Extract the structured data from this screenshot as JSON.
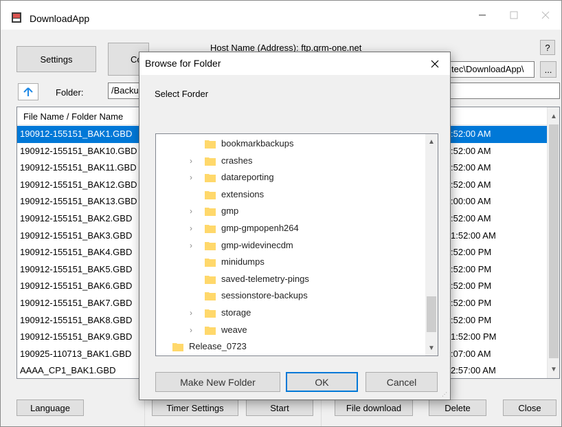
{
  "window": {
    "title": "DownloadApp"
  },
  "colors": {
    "selection": "#0078d7",
    "window_bg": "#f0f0f0"
  },
  "toolbar": {
    "settings_label": "Settings",
    "connect_label_partial": "Co",
    "host_label": "Host Name (Address): ftp.grm-one.net",
    "help_label": "?",
    "local_path": "tec\\DownloadApp\\",
    "browse_label": "...",
    "up_icon": "up-arrow-icon",
    "folder_label": "Folder:",
    "folder_value": "/Backu"
  },
  "file_list": {
    "header_name": "File Name / Folder Name",
    "rows": [
      {
        "name": "190912-155151_BAK1.GBD",
        "time": ":52:00 AM"
      },
      {
        "name": "190912-155151_BAK10.GBD",
        "time": ":52:00 AM"
      },
      {
        "name": "190912-155151_BAK11.GBD",
        "time": ":52:00 AM"
      },
      {
        "name": "190912-155151_BAK12.GBD",
        "time": ":52:00 AM"
      },
      {
        "name": "190912-155151_BAK13.GBD",
        "time": ":00:00 AM"
      },
      {
        "name": "190912-155151_BAK2.GBD",
        "time": ":52:00 AM"
      },
      {
        "name": "190912-155151_BAK3.GBD",
        "time": "1:52:00 AM"
      },
      {
        "name": "190912-155151_BAK4.GBD",
        "time": ":52:00 PM"
      },
      {
        "name": "190912-155151_BAK5.GBD",
        "time": ":52:00 PM"
      },
      {
        "name": "190912-155151_BAK6.GBD",
        "time": ":52:00 PM"
      },
      {
        "name": "190912-155151_BAK7.GBD",
        "time": ":52:00 PM"
      },
      {
        "name": "190912-155151_BAK8.GBD",
        "time": ":52:00 PM"
      },
      {
        "name": "190912-155151_BAK9.GBD",
        "time": "1:52:00 PM"
      },
      {
        "name": "190925-110713_BAK1.GBD",
        "time": ":07:00 AM"
      },
      {
        "name": "AAAA_CP1_BAK1.GBD",
        "time": "2:57:00 AM"
      }
    ]
  },
  "bottom_bar": {
    "language_label": "Language",
    "timer_settings_label": "Timer Settings",
    "start_label": "Start",
    "file_download_label": "File download",
    "delete_label": "Delete",
    "close_label": "Close"
  },
  "dialog": {
    "title": "Browse for Folder",
    "subtitle": "Select Forder",
    "folder_color": "#ffd86b",
    "tree": [
      {
        "label": "bookmarkbackups",
        "expandable": false
      },
      {
        "label": "crashes",
        "expandable": true
      },
      {
        "label": "datareporting",
        "expandable": true
      },
      {
        "label": "extensions",
        "expandable": false
      },
      {
        "label": "gmp",
        "expandable": true
      },
      {
        "label": "gmp-gmpopenh264",
        "expandable": true
      },
      {
        "label": "gmp-widevinecdm",
        "expandable": true
      },
      {
        "label": "minidumps",
        "expandable": false
      },
      {
        "label": "saved-telemetry-pings",
        "expandable": false
      },
      {
        "label": "sessionstore-backups",
        "expandable": false
      },
      {
        "label": "storage",
        "expandable": true
      },
      {
        "label": "weave",
        "expandable": true
      },
      {
        "label": "Release_0723",
        "expandable": false
      }
    ],
    "make_new_folder_label": "Make New Folder",
    "ok_label": "OK",
    "cancel_label": "Cancel"
  }
}
